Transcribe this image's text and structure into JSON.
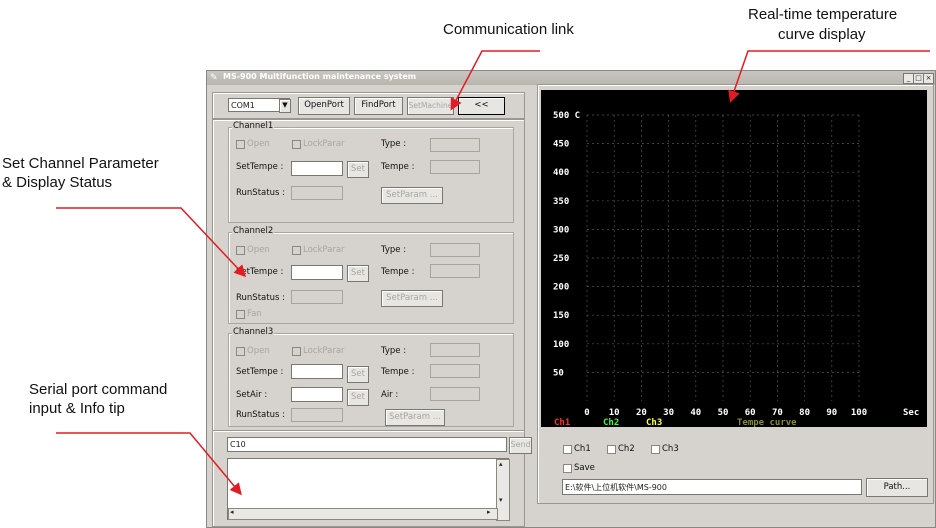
{
  "annotations": {
    "communication": "Communication link",
    "temperature_line1": "Real-time temperature",
    "temperature_line2": "curve display",
    "channel_line1": "Set Channel Parameter",
    "channel_line2": "& Display Status",
    "serial_line1": "Serial port command",
    "serial_line2": "input & Info tip"
  },
  "window": {
    "title": "MS-900 Multifunction maintenance system",
    "controls": [
      "_",
      "□",
      "×"
    ]
  },
  "toolbar": {
    "port_value": "COM1",
    "open_port": "OpenPort",
    "find_port": "FindPort",
    "set_machine": "SetMachine",
    "collapse": "<<"
  },
  "channels": [
    {
      "name": "Channel1",
      "open": "Open",
      "lock": "LockParar",
      "type_label": "Type :",
      "set_tempe_label": "SetTempe :",
      "set_btn": "Set",
      "tempe_label": "Tempe :",
      "runstatus_label": "RunStatus :",
      "setparam_btn": "SetParam ..."
    },
    {
      "name": "Channel2",
      "open": "Open",
      "lock": "LockParar",
      "type_label": "Type :",
      "set_tempe_label": "SetTempe :",
      "set_btn": "Set",
      "tempe_label": "Tempe :",
      "runstatus_label": "RunStatus :",
      "setparam_btn": "SetParam ...",
      "fan": "Fan"
    },
    {
      "name": "Channel3",
      "open": "Open",
      "lock": "LockParar",
      "type_label": "Type :",
      "set_tempe_label": "SetTempe :",
      "set_btn": "Set",
      "tempe_label": "Tempe :",
      "setair_label": "SetAir :",
      "set_btn2": "Set",
      "air_label": "Air :",
      "runstatus_label": "RunStatus :",
      "setparam_btn": "SetParam ..."
    }
  ],
  "serial": {
    "command_value": "C10",
    "send": "Send"
  },
  "chart_data": {
    "type": "line",
    "title": "Tempe curve",
    "y_ticks": [
      "500 C",
      "450",
      "400",
      "350",
      "300",
      "250",
      "200",
      "150",
      "100",
      "50"
    ],
    "x_ticks": [
      "0",
      "10",
      "20",
      "30",
      "40",
      "50",
      "60",
      "70",
      "80",
      "90",
      "100"
    ],
    "x_unit": "Sec",
    "xlim": [
      0,
      100
    ],
    "ylim": [
      0,
      500
    ],
    "grid": true,
    "series": [
      {
        "name": "Ch1",
        "color": "#ff3030",
        "values": []
      },
      {
        "name": "Ch2",
        "color": "#33ff33",
        "values": []
      },
      {
        "name": "Ch3",
        "color": "#ffff40",
        "values": []
      }
    ],
    "background": "#000000",
    "grid_color": "#555555",
    "title_color": "#8a8a30"
  },
  "chart_controls": {
    "ch1": "Ch1",
    "ch2": "Ch2",
    "ch3": "Ch3",
    "save": "Save",
    "path_value": "E:\\软件\\上位机软件\\MS-900",
    "path_btn": "Path..."
  }
}
